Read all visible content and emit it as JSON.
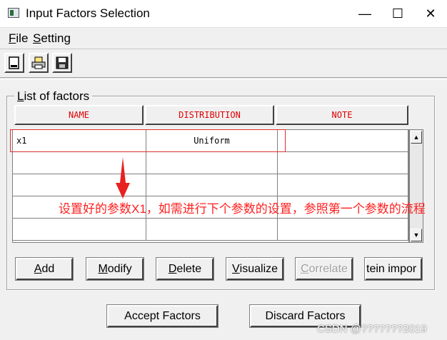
{
  "window": {
    "title": "Input Factors Selection",
    "controls": {
      "minimize": "—",
      "maximize": "☐",
      "close": "✕"
    }
  },
  "menu": {
    "file": {
      "accel": "F",
      "rest": "ile"
    },
    "setting": {
      "accel": "S",
      "rest": "etting"
    }
  },
  "toolbar": {
    "buttons": [
      {
        "icon": "new-document-icon"
      },
      {
        "icon": "print-icon"
      },
      {
        "icon": "save-icon"
      }
    ]
  },
  "factors": {
    "group_accel": "L",
    "group_rest": "ist of factors",
    "columns": [
      "NAME",
      "DISTRIBUTION",
      "NOTE"
    ],
    "rows": [
      {
        "name": "x1",
        "distribution": "Uniform",
        "note": ""
      },
      {
        "name": "",
        "distribution": "",
        "note": ""
      },
      {
        "name": "",
        "distribution": "",
        "note": ""
      },
      {
        "name": "",
        "distribution": "",
        "note": ""
      },
      {
        "name": "",
        "distribution": "",
        "note": ""
      }
    ]
  },
  "actions": {
    "add": {
      "accel": "A",
      "rest": "dd"
    },
    "modify": {
      "accel": "M",
      "rest": "odify"
    },
    "delete": {
      "accel": "D",
      "rest": "elete"
    },
    "visualize": {
      "accel": "V",
      "rest": "isualize"
    },
    "correlate": {
      "accel": "C",
      "rest": "orrelate"
    },
    "import": {
      "label": "tein impor"
    }
  },
  "footer": {
    "accept": "Accept Factors",
    "discard": "Discard Factors"
  },
  "annotation": {
    "text": "设置好的参数X1，如需进行下个参数的设置，参照第一个参数的流程",
    "color": "#ff2020"
  },
  "watermark": "CSDN @???????2019",
  "colors": {
    "header_text": "#e00000",
    "background": "#f0f0f0"
  }
}
